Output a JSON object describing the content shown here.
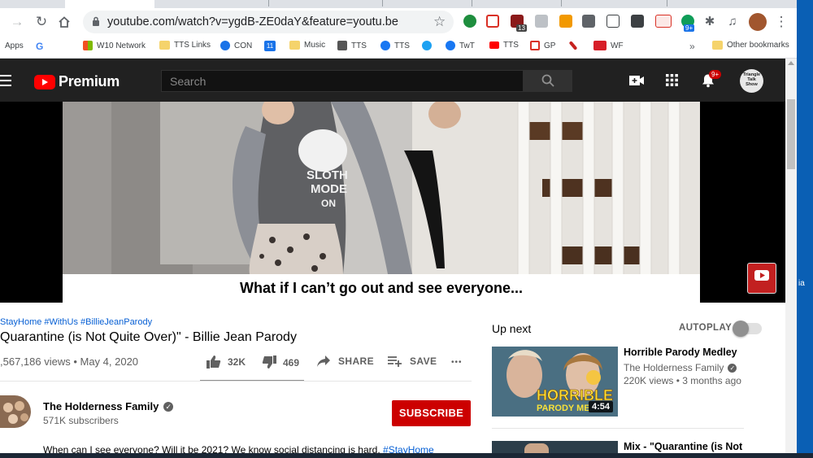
{
  "browser": {
    "url": "youtube.com/watch?v=ygdB-ZE0daY&feature=youtu.be",
    "ext_badges": [
      "13",
      "9+"
    ],
    "bookmarks": [
      {
        "label": "Apps",
        "icon": "apps-grid-icon",
        "color": "#4285f4"
      },
      {
        "label": "",
        "icon": "google-icon",
        "color": "#ea4335"
      },
      {
        "label": "W10 Network",
        "icon": "windows-icon",
        "color": "#f25022"
      },
      {
        "label": "TTS Links",
        "icon": "folder-icon",
        "color": "#f5d36b"
      },
      {
        "label": "CON",
        "icon": "contact-icon",
        "color": "#1a73e8"
      },
      {
        "label": "",
        "icon": "calendar-icon",
        "color": "#1a73e8"
      },
      {
        "label": "Music",
        "icon": "folder-icon",
        "color": "#f5d36b"
      },
      {
        "label": "TTS",
        "icon": "tts-icon",
        "color": "#555555"
      },
      {
        "label": "TTS",
        "icon": "facebook-icon",
        "color": "#1877f2"
      },
      {
        "label": "",
        "icon": "twitter-icon",
        "color": "#1da1f2"
      },
      {
        "label": "TwT",
        "icon": "facebook-icon",
        "color": "#1877f2"
      },
      {
        "label": "TTS",
        "icon": "youtube-icon",
        "color": "#ff0000"
      },
      {
        "label": "GP",
        "icon": "gmail-icon",
        "color": "#d93025"
      },
      {
        "label": "",
        "icon": "feather-icon",
        "color": "#c5221f"
      },
      {
        "label": "WF",
        "icon": "wf-icon",
        "color": "#d71e28"
      },
      {
        "label": "Other bookmarks",
        "icon": "folder-icon",
        "color": "#f5d36b"
      }
    ],
    "more_bookmarks": "»"
  },
  "youtube": {
    "logo_text": "Premium",
    "search_placeholder": "Search",
    "notif_badge": "9+",
    "avatar_text": "Triangle Talk Show",
    "caption": "What if I can’t go out and see everyone...",
    "hashtags": "StayHome #WithUs #BillieJeanParody",
    "title": "Quarantine (is Not Quite Over)\" - Billie Jean Parody",
    "views_date": ",567,186 views • May 4, 2020",
    "likes": "32K",
    "dislikes": "469",
    "share_label": "SHARE",
    "save_label": "SAVE",
    "more_label": "•••",
    "channel_name": "The Holderness Family",
    "subscribers": "571K subscribers",
    "subscribe_label": "SUBSCRIBE",
    "description": "When can I see everyone? Will it be 2021? We know social distancing is hard.",
    "desc_hashtag": "#StayHome",
    "up_next": "Up next",
    "autoplay": "AUTOPLAY",
    "recs": [
      {
        "title": "Horrible Parody Medley",
        "channel": "The Holderness Family",
        "meta": "220K views • 3 months ago",
        "duration": "4:54",
        "thumb_text": "HORRIBLE PARODY ME"
      },
      {
        "title": "Mix - \"Quarantine (is Not",
        "channel": "",
        "meta": "",
        "duration": "",
        "thumb_text": ""
      }
    ],
    "side_label": "ia"
  }
}
